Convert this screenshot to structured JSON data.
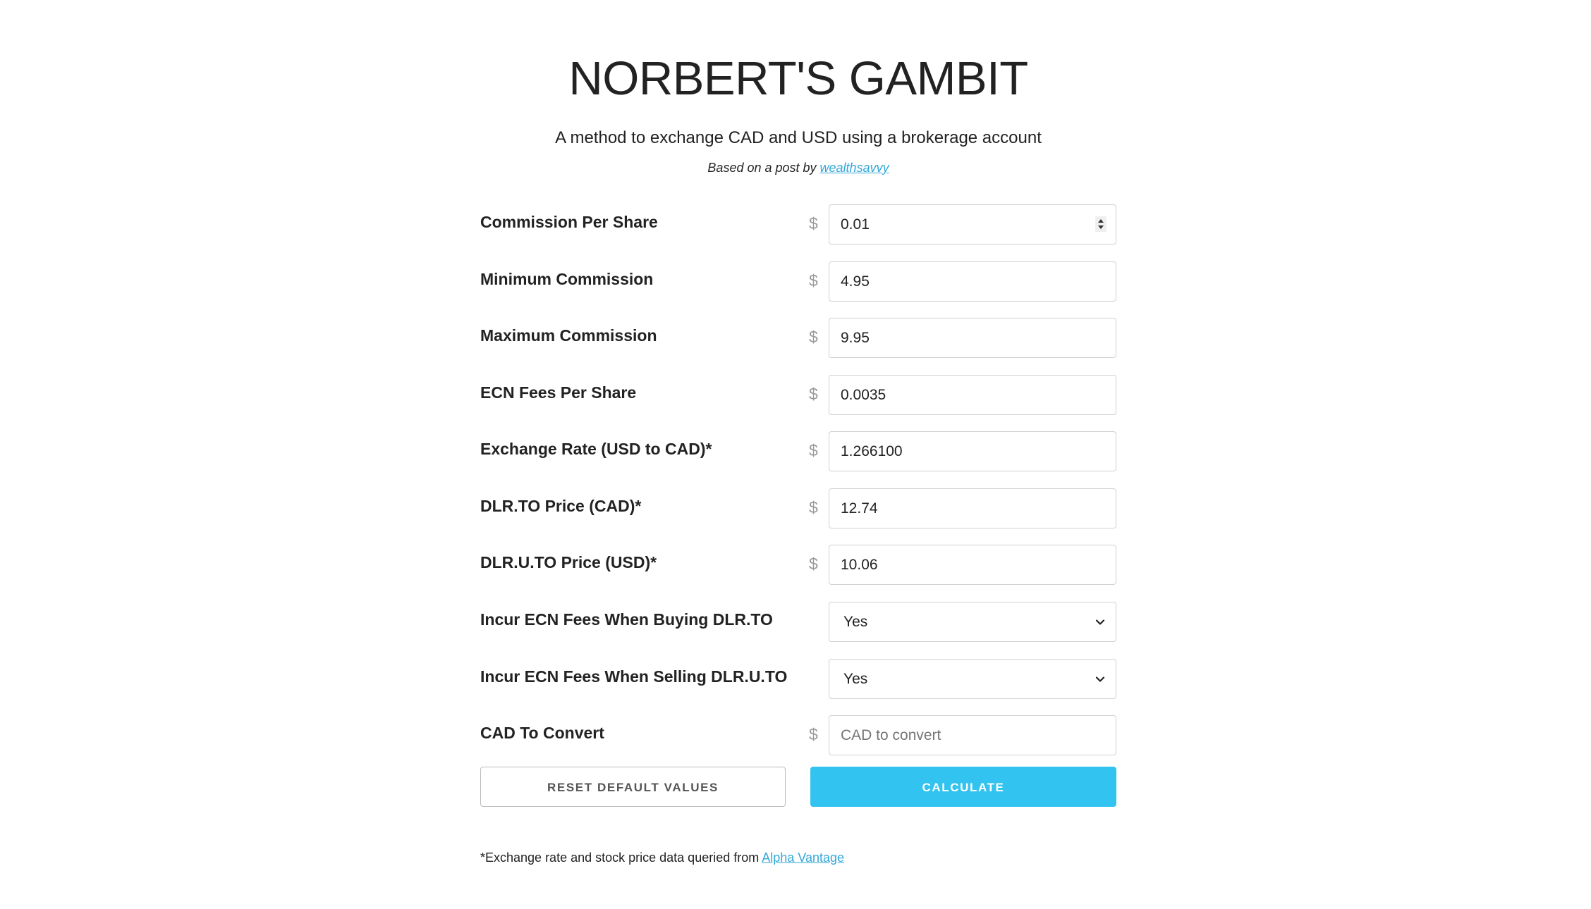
{
  "header": {
    "title": "NORBERT'S GAMBIT",
    "subtitle": "A method to exchange CAD and USD using a brokerage account",
    "credit_prefix": "Based on a post by ",
    "credit_link": "wealthsavvy"
  },
  "form": {
    "currency_symbol": "$",
    "commission_per_share": {
      "label": "Commission Per Share",
      "value": "0.01"
    },
    "minimum_commission": {
      "label": "Minimum Commission",
      "value": "4.95"
    },
    "maximum_commission": {
      "label": "Maximum Commission",
      "value": "9.95"
    },
    "ecn_fees_per_share": {
      "label": "ECN Fees Per Share",
      "value": "0.0035"
    },
    "exchange_rate": {
      "label": "Exchange Rate (USD to CAD)*",
      "value": "1.266100"
    },
    "dlr_to_price": {
      "label": "DLR.TO Price (CAD)*",
      "value": "12.74"
    },
    "dlr_u_to_price": {
      "label": "DLR.U.TO Price (USD)*",
      "value": "10.06"
    },
    "ecn_buying": {
      "label": "Incur ECN Fees When Buying DLR.TO",
      "selected": "Yes"
    },
    "ecn_selling": {
      "label": "Incur ECN Fees When Selling DLR.U.TO",
      "selected": "Yes"
    },
    "cad_to_convert": {
      "label": "CAD To Convert",
      "value": "",
      "placeholder": "CAD to convert"
    }
  },
  "buttons": {
    "reset_label": "RESET DEFAULT VALUES",
    "calculate_label": "CALCULATE"
  },
  "footer": {
    "note_prefix": "*Exchange rate and stock price data queried from ",
    "note_link": "Alpha Vantage"
  },
  "colors": {
    "accent": "#33c3f0",
    "link": "#33a7d8",
    "text": "#222222"
  }
}
